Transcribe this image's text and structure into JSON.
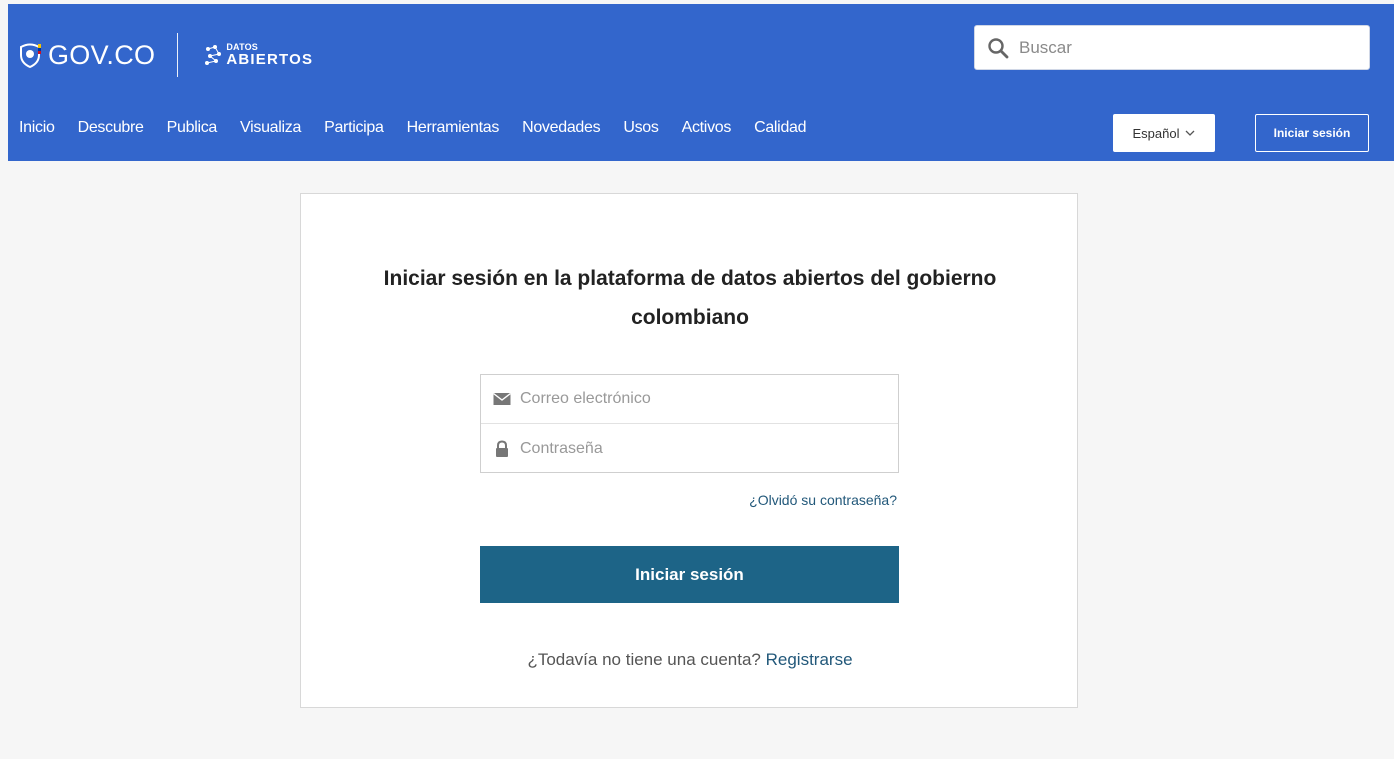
{
  "header": {
    "brand": "GOV.CO",
    "datos_logo_small": "DATOS",
    "datos_logo_big": "ABIERTOS",
    "search_placeholder": "Buscar",
    "nav_items": [
      "Inicio",
      "Descubre",
      "Publica",
      "Visualiza",
      "Participa",
      "Herramientas",
      "Novedades",
      "Usos",
      "Activos",
      "Calidad"
    ],
    "language": "Español",
    "login_button": "Iniciar sesión"
  },
  "login_card": {
    "title": "Iniciar sesión en la plataforma de datos abiertos del gobierno colombiano",
    "email_placeholder": "Correo electrónico",
    "password_placeholder": "Contraseña",
    "forgot_password": "¿Olvidó su contraseña?",
    "submit_label": "Iniciar sesión",
    "no_account_text": "¿Todavía no tiene una cuenta?",
    "register_link": "Registrarse"
  },
  "colors": {
    "header_bg": "#3366cc",
    "primary_button": "#1d6487",
    "link": "#22587a",
    "page_bg": "#f6f6f6"
  },
  "icons": {
    "search": "magnifier-icon",
    "email": "envelope-icon",
    "password": "lock-icon",
    "language": "chevron-down-icon"
  }
}
